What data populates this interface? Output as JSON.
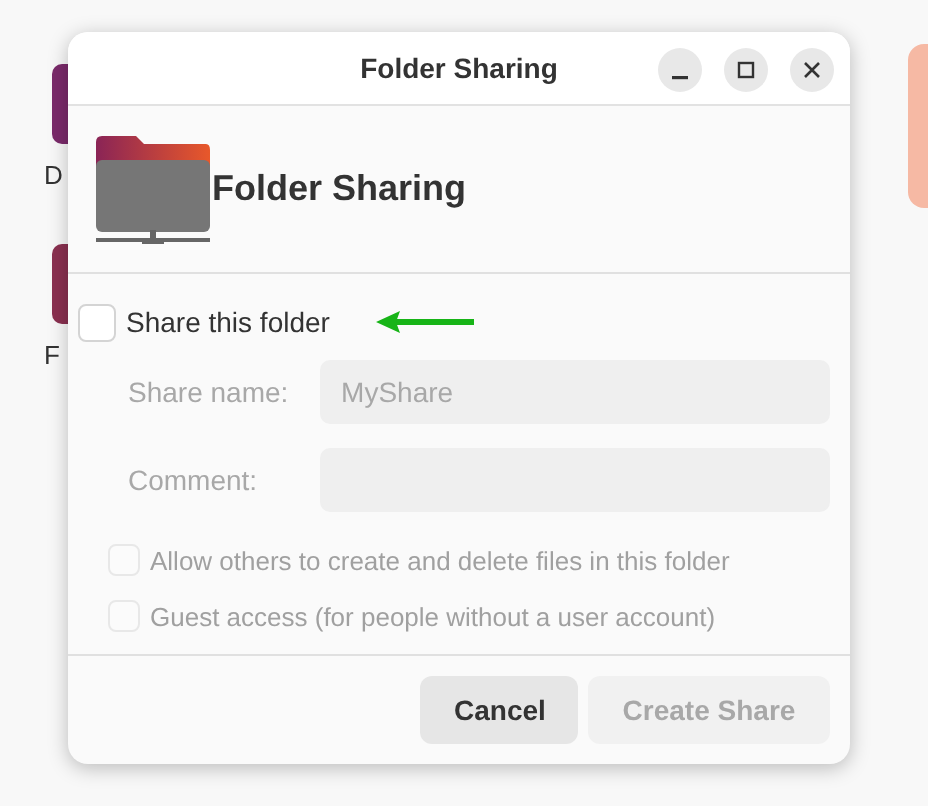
{
  "desktop": {
    "icons": [
      {
        "label": "D",
        "color": "#7a2a6a"
      },
      {
        "label": "F",
        "color": "#8a3050"
      }
    ]
  },
  "window": {
    "title": "Folder Sharing"
  },
  "header": {
    "title": "Folder Sharing"
  },
  "share_toggle": {
    "label": "Share this folder",
    "checked": false
  },
  "fields": [
    {
      "label": "Share name:",
      "value": "MyShare",
      "disabled": true
    },
    {
      "label": "Comment:",
      "disabled": true
    }
  ],
  "options": [
    {
      "label": "Allow others to create and delete files in this folder",
      "checked": false,
      "disabled": true
    },
    {
      "label": "Guest access (for people without a user account)",
      "checked": false,
      "disabled": true
    }
  ],
  "buttons": [
    {
      "label": "Cancel",
      "disabled": false
    },
    {
      "label": "Create Share",
      "disabled": true
    }
  ]
}
